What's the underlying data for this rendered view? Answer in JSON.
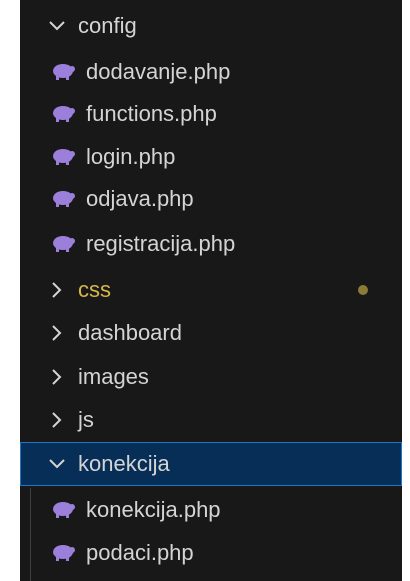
{
  "colors": {
    "panel_bg": "#181818",
    "text": "#d4d4d4",
    "modified_text": "#d8b64c",
    "modified_dot": "#8c7a39",
    "selected_bg": "#062e57",
    "selected_border": "#1f75c7",
    "php_icon": "#9b7fdb"
  },
  "tree": {
    "config": {
      "label": "config",
      "expanded": true,
      "files": [
        "dodavanje.php",
        "functions.php",
        "login.php",
        "odjava.php",
        "registracija.php"
      ]
    },
    "collapsed_folders": [
      {
        "label": "css",
        "modified": true
      },
      {
        "label": "dashboard",
        "modified": false
      },
      {
        "label": "images",
        "modified": false
      },
      {
        "label": "js",
        "modified": false
      }
    ],
    "konekcija": {
      "label": "konekcija",
      "expanded": true,
      "selected": true,
      "files": [
        "konekcija.php",
        "podaci.php"
      ]
    }
  }
}
